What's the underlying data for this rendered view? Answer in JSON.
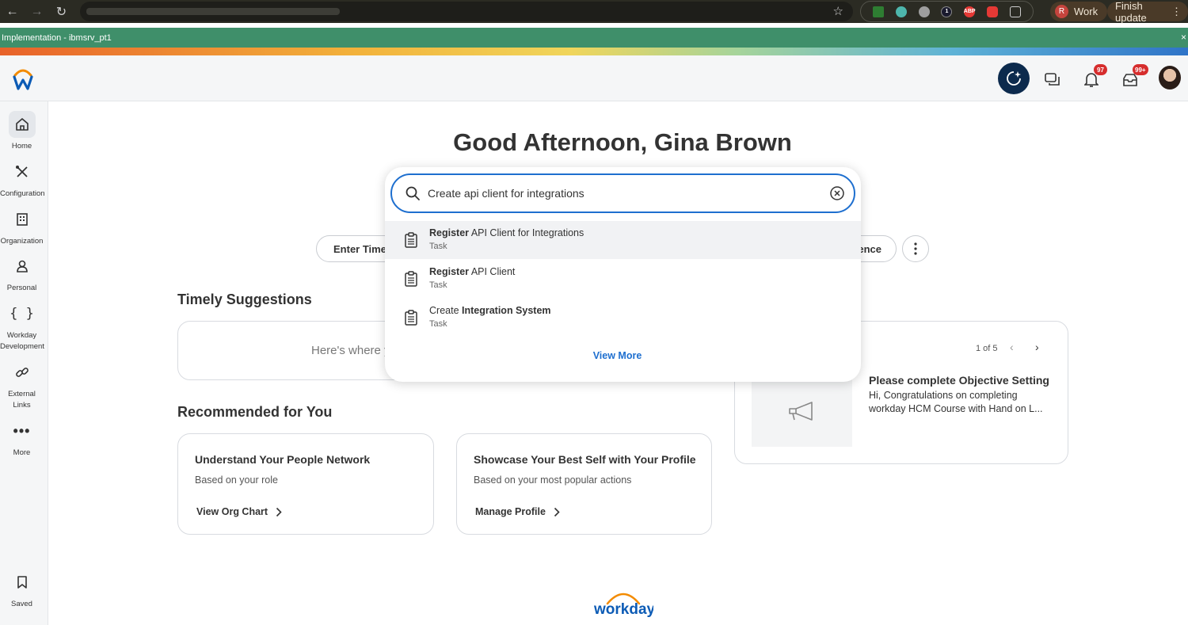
{
  "browser": {
    "profile_initial": "R",
    "profile_label": "Work",
    "update_label": "Finish update",
    "extensions": [
      "download-ext-icon",
      "shield-ext-icon",
      "sync-ext-icon",
      "onepassword-ext-icon",
      "adblock-ext-icon",
      "security-ext-icon",
      "puzzle-icon"
    ],
    "onepassword_text": "1",
    "abp_text": "ABP"
  },
  "tenant": {
    "label": "Implementation - ibmsrv_pt1",
    "close": "×"
  },
  "header": {
    "notifications_count": "97",
    "inbox_count": "99+"
  },
  "sidebar": {
    "items": [
      {
        "label": "Home"
      },
      {
        "label": "Configuration"
      },
      {
        "label": "Organization"
      },
      {
        "label": "Personal"
      },
      {
        "label": "Workday Development"
      },
      {
        "label": "External Links"
      },
      {
        "label": "More"
      },
      {
        "label": "Saved"
      }
    ]
  },
  "main": {
    "greeting": "Good Afternoon, Gina Brown",
    "quick_actions": [
      "Enter Time",
      "ence"
    ],
    "timely_title": "Timely Suggestions",
    "timely_text": "Here's where y",
    "recommended_title": "Recommended for You",
    "recommended": [
      {
        "title": "Understand Your People Network",
        "subtitle": "Based on your role",
        "link": "View Org Chart"
      },
      {
        "title": "Showcase Your Best Self with Your Profile",
        "subtitle": "Based on your most popular actions",
        "link": "Manage Profile"
      }
    ],
    "announcement": {
      "pager": "1 of 5",
      "title": "Please complete Objective Setting",
      "body": "Hi, Congratulations on completing workday HCM Course with Hand on L..."
    },
    "footer_logo": "workday."
  },
  "search": {
    "value": "Create api client for integrations",
    "results": [
      {
        "bold": "Register",
        "rest": " API Client for Integrations",
        "type": "Task"
      },
      {
        "bold": "Register",
        "rest": " API Client",
        "type": "Task"
      },
      {
        "plain": "Create ",
        "bold": "Integration System",
        "type": "Task"
      }
    ],
    "view_more": "View More"
  },
  "colors": {
    "tenant_banner": "#3f8f6a",
    "accent_blue": "#1e6fcf",
    "assistant_navy": "#0c2a4d",
    "badge_red": "#d62d2d",
    "workday_orange": "#f38b00"
  }
}
